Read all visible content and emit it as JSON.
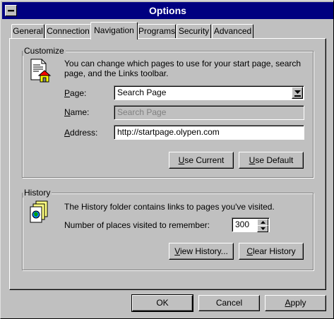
{
  "window": {
    "title": "Options"
  },
  "tabs": [
    {
      "label": "General"
    },
    {
      "label": "Connection"
    },
    {
      "label": "Navigation"
    },
    {
      "label": "Programs"
    },
    {
      "label": "Security"
    },
    {
      "label": "Advanced"
    }
  ],
  "customize": {
    "group_label": "Customize",
    "description_line1": "You can change which pages to use for your start page, search",
    "description_line2": "page, and the Links toolbar.",
    "page": {
      "label_mnemonic": "P",
      "label_rest": "age:",
      "value": "Search Page"
    },
    "name": {
      "label_mnemonic": "N",
      "label_rest": "ame:",
      "value": "Search Page"
    },
    "address": {
      "label_mnemonic": "A",
      "label_rest": "ddress:",
      "value": "http://startpage.olypen.com"
    },
    "use_current": {
      "mnemonic": "U",
      "rest": "se Current"
    },
    "use_default": {
      "mnemonic": "U",
      "rest": "se Default"
    }
  },
  "history": {
    "group_label": "History",
    "description": "The History folder contains links to pages you've visited.",
    "places_label": "Number of places visited to remember:",
    "places_value": "300",
    "view_history": {
      "mnemonic": "V",
      "rest": "iew History..."
    },
    "clear_history": {
      "mnemonic": "C",
      "rest": "lear History"
    }
  },
  "footer": {
    "ok_label": "OK",
    "cancel_label": "Cancel",
    "apply_mnemonic": "A",
    "apply_rest": "pply"
  },
  "colors": {
    "titlebar": "#000080",
    "face": "#c0c0c0"
  }
}
